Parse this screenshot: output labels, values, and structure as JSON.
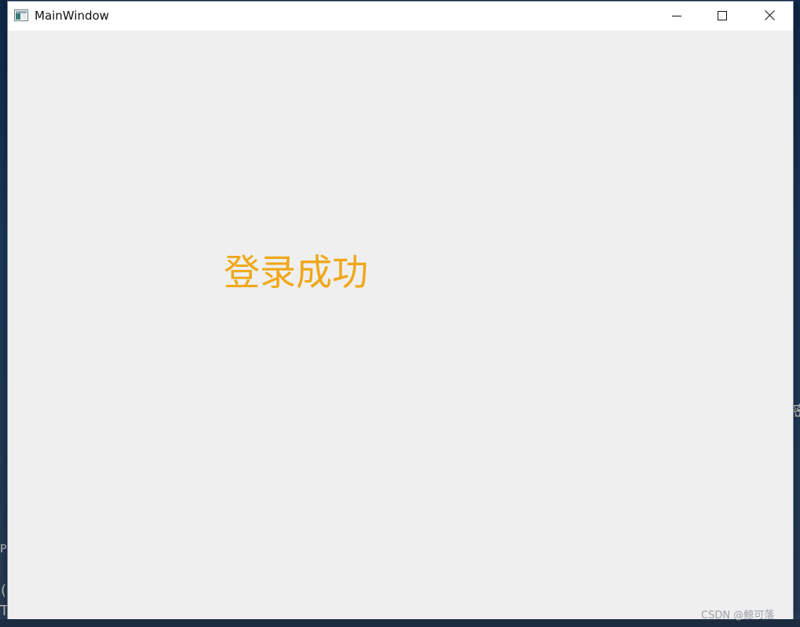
{
  "window": {
    "title": "MainWindow",
    "icon": "qt-window-icon"
  },
  "controls": {
    "minimize_icon": "minimize-icon",
    "maximize_icon": "maximize-icon",
    "close_icon": "close-icon"
  },
  "content": {
    "status_text": "登录成功",
    "status_color": "#f0a818"
  },
  "desktop": {
    "edge_left_top": "P",
    "edge_left_mid": "(",
    "edge_left_bottom": "T",
    "edge_right": "密"
  },
  "watermark": "CSDN @鲸可落"
}
